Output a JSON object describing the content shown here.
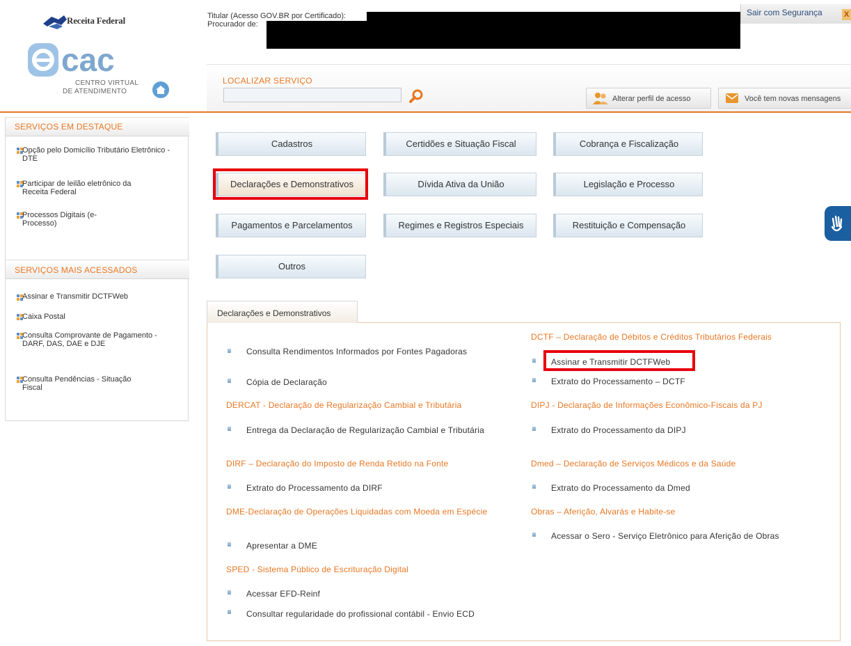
{
  "header": {
    "brand": "Receita Federal",
    "ecac_sub1": "CENTRO VIRTUAL",
    "ecac_sub2": "DE ATENDIMENTO",
    "titular": "Titular (Acesso GOV.BR por Certificado):",
    "procurador": "Procurador de:",
    "logout": "Sair com Segurança",
    "logout_x": "X",
    "search_title": "LOCALIZAR SERVIÇO",
    "search_value": "",
    "alter_profile": "Alterar perfil de acesso",
    "messages": "Você tem novas mensagens"
  },
  "sidebar": {
    "featured_title": "SERVIÇOS EM DESTAQUE",
    "featured": [
      "Opção pelo Domicílio Tributário Eletrônico - DTE",
      "Participar de leilão eletrônico da Receita Federal",
      "Processos Digitais (e-Processo)"
    ],
    "most_title": "SERVIÇOS MAIS ACESSADOS",
    "most": [
      "Assinar e Transmitir DCTFWeb",
      "Caixa Postal",
      "Consulta Comprovante de Pagamento - DARF, DAS, DAE e DJE",
      "Consulta Pendências - Situação Fiscal"
    ]
  },
  "categories": [
    "Cadastros",
    "Certidões e Situação Fiscal",
    "Cobrança e Fiscalização",
    "Declarações e Demonstrativos",
    "Dívida Ativa da União",
    "Legislação e Processo",
    "Pagamentos e Parcelamentos",
    "Regimes e Registros Especiais",
    "Restituição e Compensação",
    "Outros"
  ],
  "tab": {
    "label": "Declarações e Demonstrativos"
  },
  "left_col": {
    "items_top": [
      "Consulta Rendimentos Informados por Fontes Pagadoras",
      "Cópia de Declaração"
    ],
    "dercat_title": "DERCAT - Declaração de Regularização Cambial e Tributária",
    "dercat_items": [
      "Entrega da Declaração de Regularização Cambial e Tributária"
    ],
    "dirf_title": "DIRF – Declaração do Imposto de Renda Retido na Fonte",
    "dirf_items": [
      "Extrato do Processamento da DIRF"
    ],
    "dme_title": "DME-Declaração de Operações Liquidadas com Moeda em Espécie",
    "dme_items": [
      "Apresentar a DME"
    ],
    "sped_title": "SPED - Sistema Público de Escrituração Digital",
    "sped_items": [
      "Acessar EFD-Reinf",
      "Consultar regularidade do profissional contábil - Envio ECD"
    ]
  },
  "right_col": {
    "dctf_title": "DCTF – Declaração de Débitos e Créditos Tributários Federais",
    "dctf_items": [
      "Assinar e Transmitir DCTFWeb",
      "Extrato do Processamento – DCTF"
    ],
    "dipj_title": "DIPJ - Declaração de Informações Econômico-Fiscais da PJ",
    "dipj_items": [
      "Extrato do Processamento da DIPJ"
    ],
    "dmed_title": "Dmed – Declaração de Serviços Médicos e da Saúde",
    "dmed_items": [
      "Extrato do Processamento da Dmed"
    ],
    "obras_title": "Obras – Aferição, Alvarás e Habite-se",
    "obras_items": [
      "Acessar o Sero - Serviço Eletrônico para Aferição de Obras"
    ]
  },
  "colors": {
    "accent": "#e87722",
    "highlight": "#e8000b",
    "button": "#dbe6ef"
  }
}
